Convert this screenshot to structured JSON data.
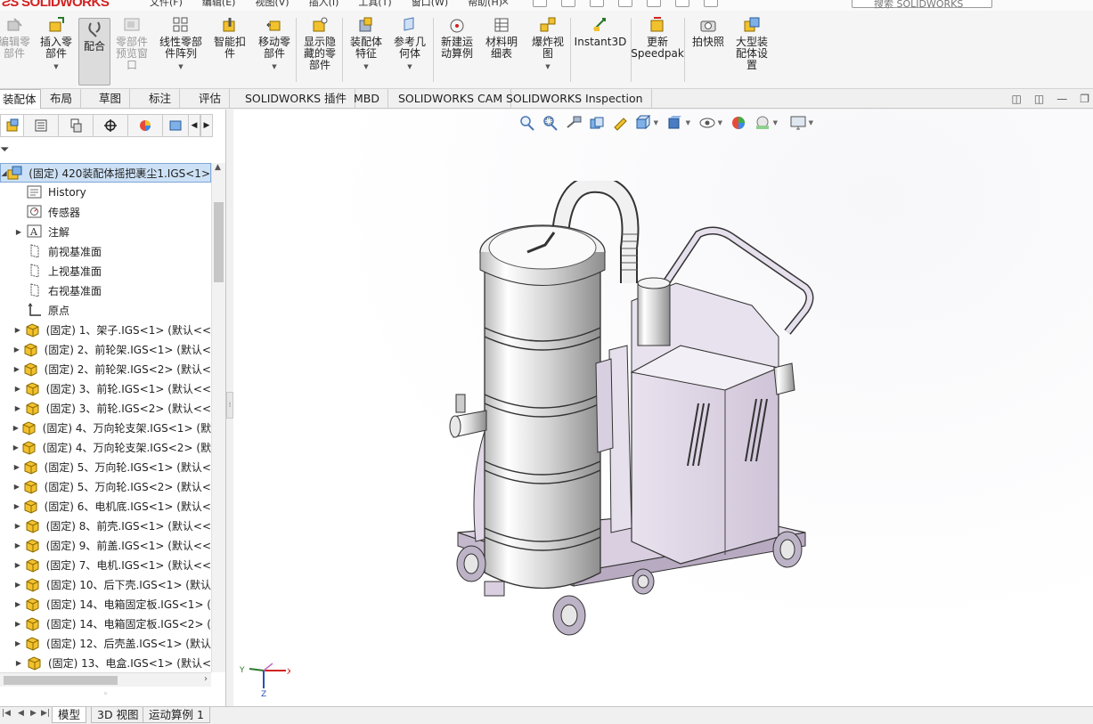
{
  "app": {
    "logo_prefix": "ƧS",
    "logo_text": "SOLIDWORKS"
  },
  "menubar": {
    "menus": [
      "文件(F)",
      "编辑(E)",
      "视图(V)",
      "插入(I)",
      "工具(T)",
      "窗口(W)",
      "帮助(H)"
    ],
    "search_placeholder": "搜索 SOLIDWORKS"
  },
  "ribbon": {
    "buttons": [
      {
        "label": "编辑零\n部件",
        "icon": "edit-component-icon",
        "disabled": true
      },
      {
        "label": "插入零\n部件",
        "icon": "insert-component-icon",
        "dropdown": true
      },
      {
        "label": "配合",
        "icon": "mate-icon",
        "active": true
      },
      {
        "label": "零部件\n预览窗\n口",
        "icon": "component-preview-icon",
        "disabled": true
      },
      {
        "label": "线性零部\n件阵列",
        "icon": "linear-pattern-icon",
        "dropdown": true
      },
      {
        "label": "智能扣\n件",
        "icon": "smart-fasteners-icon"
      },
      {
        "label": "移动零\n部件",
        "icon": "move-component-icon",
        "dropdown": true
      },
      {
        "label": "显示隐\n藏的零\n部件",
        "icon": "show-hidden-icon"
      },
      {
        "label": "装配体\n特征",
        "icon": "assembly-feature-icon",
        "dropdown": true
      },
      {
        "label": "参考几\n何体",
        "icon": "reference-geometry-icon",
        "dropdown": true
      },
      {
        "label": "新建运\n动算例",
        "icon": "new-motion-study-icon"
      },
      {
        "label": "材料明\n细表",
        "icon": "bill-of-materials-icon"
      },
      {
        "label": "爆炸视\n图",
        "icon": "exploded-view-icon",
        "dropdown": true
      },
      {
        "label": "Instant3D",
        "icon": "instant3d-icon"
      },
      {
        "label": "更新\nSpeedpak",
        "icon": "speedpak-icon"
      },
      {
        "label": "拍快照",
        "icon": "snapshot-icon"
      },
      {
        "label": "大型装\n配体设\n置",
        "icon": "large-assembly-icon"
      }
    ]
  },
  "command_tabs": [
    "装配体",
    "布局",
    "草图",
    "标注",
    "评估",
    "SOLIDWORKS 插件",
    "MBD",
    "SOLIDWORKS CAM",
    "SOLIDWORKS Inspection"
  ],
  "feature_tree": {
    "root": "(固定) 420装配体摇把裹尘1.IGS<1>",
    "items": [
      {
        "label": "History",
        "icon": "history-icon"
      },
      {
        "label": "传感器",
        "icon": "sensor-icon"
      },
      {
        "label": "注解",
        "icon": "annotation-icon",
        "expandable": true
      },
      {
        "label": "前视基准面",
        "icon": "plane-icon"
      },
      {
        "label": "上视基准面",
        "icon": "plane-icon"
      },
      {
        "label": "右视基准面",
        "icon": "plane-icon"
      },
      {
        "label": "原点",
        "icon": "origin-icon"
      },
      {
        "label": "(固定) 1、架子.IGS<1> (默认<<",
        "icon": "part-icon",
        "expandable": true
      },
      {
        "label": "(固定) 2、前轮架.IGS<1> (默认<",
        "icon": "part-icon",
        "expandable": true
      },
      {
        "label": "(固定) 2、前轮架.IGS<2> (默认<",
        "icon": "part-icon",
        "expandable": true
      },
      {
        "label": "(固定) 3、前轮.IGS<1> (默认<<",
        "icon": "part-icon",
        "expandable": true
      },
      {
        "label": "(固定) 3、前轮.IGS<2> (默认<<",
        "icon": "part-icon",
        "expandable": true
      },
      {
        "label": "(固定) 4、万向轮支架.IGS<1> (默",
        "icon": "part-icon",
        "expandable": true
      },
      {
        "label": "(固定) 4、万向轮支架.IGS<2> (默",
        "icon": "part-icon",
        "expandable": true
      },
      {
        "label": "(固定) 5、万向轮.IGS<1> (默认<",
        "icon": "part-icon",
        "expandable": true
      },
      {
        "label": "(固定) 5、万向轮.IGS<2> (默认<",
        "icon": "part-icon",
        "expandable": true
      },
      {
        "label": "(固定) 6、电机底.IGS<1> (默认<",
        "icon": "part-icon",
        "expandable": true
      },
      {
        "label": "(固定) 8、前壳.IGS<1> (默认<<",
        "icon": "part-icon",
        "expandable": true
      },
      {
        "label": "(固定) 9、前盖.IGS<1> (默认<<",
        "icon": "part-icon",
        "expandable": true
      },
      {
        "label": "(固定) 7、电机.IGS<1> (默认<<",
        "icon": "part-icon",
        "expandable": true
      },
      {
        "label": "(固定) 10、后下壳.IGS<1> (默认",
        "icon": "part-icon",
        "expandable": true
      },
      {
        "label": "(固定) 14、电箱固定板.IGS<1> (",
        "icon": "part-icon",
        "expandable": true
      },
      {
        "label": "(固定) 14、电箱固定板.IGS<2> (",
        "icon": "part-icon",
        "expandable": true
      },
      {
        "label": "(固定) 12、后壳盖.IGS<1> (默认",
        "icon": "part-icon",
        "expandable": true
      },
      {
        "label": "(固定) 13、电盒.IGS<1> (默认<",
        "icon": "part-icon",
        "expandable": true
      }
    ]
  },
  "triad": {
    "x": "X",
    "y": "Y",
    "z": "Z"
  },
  "bottom_tabs": [
    "模型",
    "3D 视图",
    "运动算例 1"
  ],
  "colors": {
    "accent": "#d32121",
    "selection": "#cde1f6",
    "part_yellow": "#f2c12e",
    "machine_frame": "#d9cfe0"
  }
}
